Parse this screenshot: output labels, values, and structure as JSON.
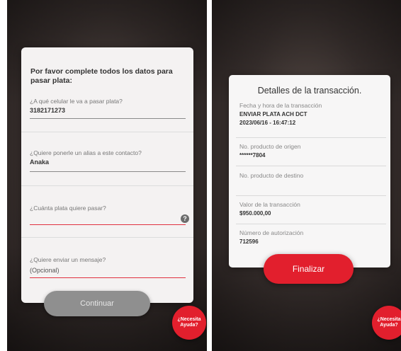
{
  "form": {
    "title": "Por favor complete todos los datos para pasar plata:",
    "phone_label": "¿A qué celular le va a pasar plata?",
    "phone_value": "3182171273",
    "alias_label": "¿Quiere ponerle un alias a este contacto?",
    "alias_value": "Anaka",
    "amount_label": "¿Cuánta plata quiere pasar?",
    "amount_help_icon": "?",
    "message_label": "¿Quiere enviar un mensaje?",
    "message_value": "(Opcional)",
    "continue_label": "Continuar"
  },
  "help_bubble": {
    "label": "¿Necesita Ayuda?"
  },
  "details": {
    "title": "Detalles de la transacción.",
    "rows": [
      {
        "label": "Fecha y hora de la transacción",
        "value": "ENVIAR PLATA ACH DCT",
        "value2": "2023/06/16 - 16:47:12"
      },
      {
        "label": "No. producto de origen",
        "value": "******7804"
      },
      {
        "label": "No. producto de destino",
        "value": ""
      },
      {
        "label": "Valor de la transacción",
        "value": "$950.000,00"
      },
      {
        "label": "Número de autorización",
        "value": "712596"
      }
    ],
    "finish_label": "Finalizar"
  },
  "colors": {
    "accent": "#e21f2d",
    "disabled_button": "#8f8f8f"
  }
}
